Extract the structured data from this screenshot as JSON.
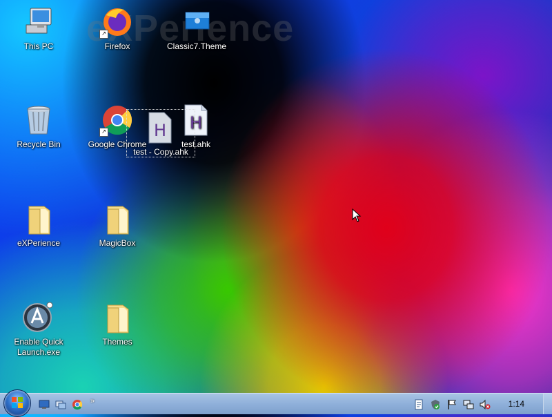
{
  "watermark": "eXPerience",
  "desktop": {
    "icons": [
      {
        "label": "This PC"
      },
      {
        "label": "Firefox"
      },
      {
        "label": "Classic7.Theme"
      },
      {
        "label": "Recycle Bin"
      },
      {
        "label": "Google Chrome"
      },
      {
        "label": "test.ahk"
      },
      {
        "label": "eXPerience"
      },
      {
        "label": "MagicBox"
      },
      {
        "label": "Enable Quick Launch.exe"
      },
      {
        "label": "Themes"
      }
    ],
    "drag_ghost_label": "test - Copy.ahk"
  },
  "taskbar": {
    "quick_launch_icons": [
      "show-desktop-icon",
      "switch-windows-icon",
      "chrome-icon"
    ],
    "overflow_label": "»",
    "tray_icons": [
      "document-icon",
      "security-shield-icon",
      "action-center-flag-icon",
      "network-icon",
      "volume-muted-icon"
    ],
    "clock": "1:14"
  },
  "colors": {
    "taskbar": "#8fb0da",
    "folder": "#f0d27a",
    "ahk_letter": "#6a3a9c"
  }
}
